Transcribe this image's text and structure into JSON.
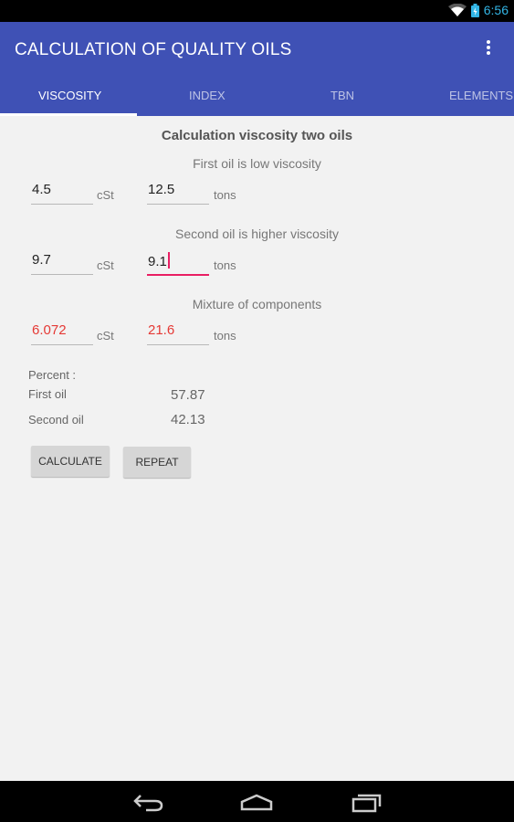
{
  "status_bar": {
    "time": "6:56",
    "icons": [
      "wifi-icon",
      "battery-icon"
    ]
  },
  "app_bar": {
    "title": "CALCULATION OF QUALITY OILS",
    "menu_icon": "more-vert-icon"
  },
  "tabs": [
    {
      "label": "VISCOSITY",
      "active": true
    },
    {
      "label": "INDEX",
      "active": false
    },
    {
      "label": "TBN",
      "active": false
    },
    {
      "label": "ELEMENTS",
      "active": false
    }
  ],
  "main": {
    "heading": "Calculation viscosity two oils",
    "first_oil": {
      "title": "First oil is low viscosity",
      "viscosity": "4.5",
      "viscosity_unit": "cSt",
      "amount": "12.5",
      "amount_unit": "tons"
    },
    "second_oil": {
      "title": "Second oil is higher viscosity",
      "viscosity": "9.7",
      "viscosity_unit": "cSt",
      "amount": "9.1",
      "amount_unit": "tons"
    },
    "mixture": {
      "title": "Mixture of components",
      "viscosity": "6.072",
      "viscosity_unit": "cSt",
      "amount": "21.6",
      "amount_unit": "tons"
    },
    "percent": {
      "label": "Percent :",
      "first_label": "First oil",
      "first_value": "57.87",
      "second_label": "Second oil",
      "second_value": "42.13"
    },
    "buttons": {
      "calculate": "CALCULATE",
      "repeat": "REPEAT"
    }
  },
  "colors": {
    "primary": "#3f51b5",
    "result_red": "#e53935",
    "focus_pink": "#e91e63"
  },
  "nav_icons": [
    "back-icon",
    "home-icon",
    "recents-icon"
  ]
}
